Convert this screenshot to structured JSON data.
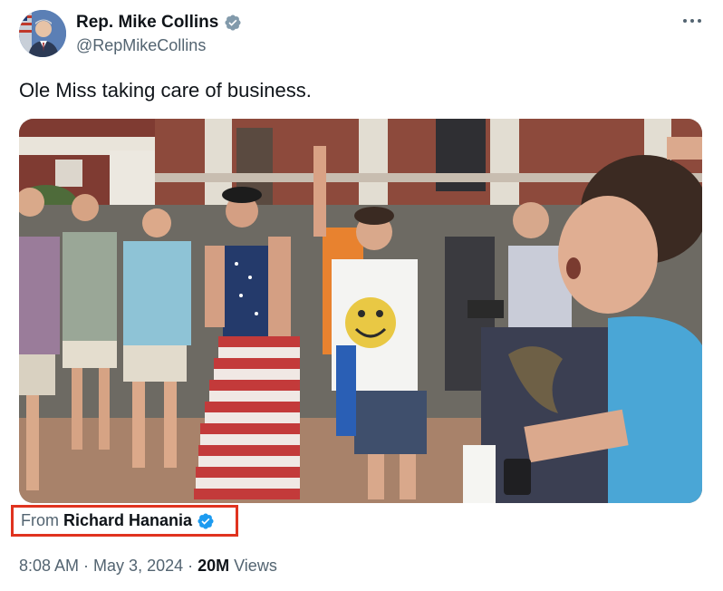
{
  "author": {
    "display_name": "Rep. Mike Collins",
    "handle": "@RepMikeCollins",
    "avatar_icon": "profile-photo-avatar",
    "verified_color": "#1d9bf0",
    "verified_icon": "verified-badge-icon"
  },
  "more_icon": "more-options-icon",
  "tweet": {
    "text": "Ole Miss taking care of business."
  },
  "media": {
    "kind": "photo",
    "description_icon": "embedded-photo"
  },
  "source": {
    "from_label": "From",
    "from_name": "Richard Hanania",
    "highlight_color": "#e0331f",
    "verified_color": "#1d9bf0"
  },
  "meta": {
    "time": "8:08 AM",
    "separator": "·",
    "date": "May 3, 2024",
    "views_count": "20M",
    "views_label": "Views"
  }
}
